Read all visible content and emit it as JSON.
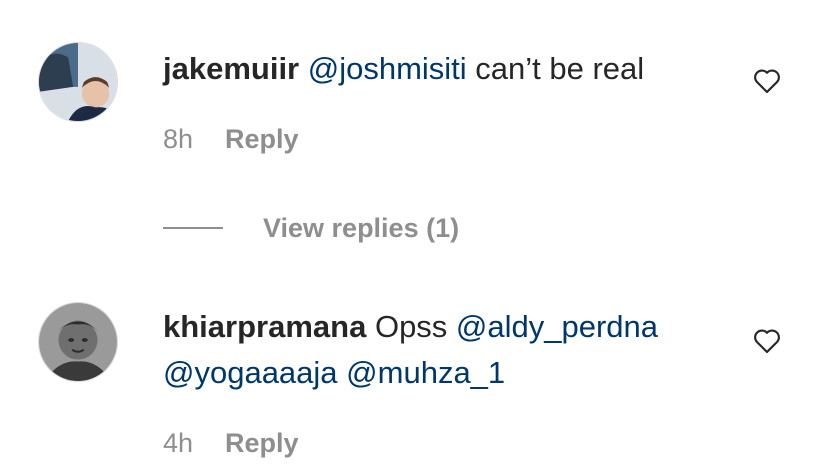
{
  "comments": [
    {
      "username": "jakemuiir",
      "text_parts": [
        "@joshmisiti",
        " can’t be real"
      ],
      "time": "8h",
      "reply_label": "Reply",
      "view_replies_label": "View replies (1)"
    },
    {
      "username": "khiarpramana",
      "text_parts": [
        "Opss ",
        "@aldy_perdna",
        "@yogaaaaja",
        " ",
        "@muhza_1"
      ],
      "time": "4h",
      "reply_label": "Reply"
    }
  ],
  "colors": {
    "mention": "#00376b",
    "username": "#262626",
    "meta": "#8e8e8e",
    "background": "#ffffff"
  },
  "icons": {
    "like": "heart-outline-icon"
  }
}
